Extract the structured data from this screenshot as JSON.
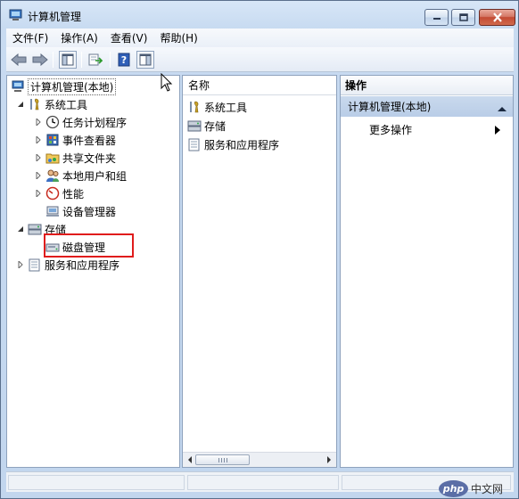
{
  "window": {
    "title": "计算机管理"
  },
  "menubar": {
    "items": [
      "文件(F)",
      "操作(A)",
      "查看(V)",
      "帮助(H)"
    ]
  },
  "tree": {
    "root": "计算机管理(本地)",
    "system_tools": "系统工具",
    "task_scheduler": "任务计划程序",
    "event_viewer": "事件查看器",
    "shared_folders": "共享文件夹",
    "local_users": "本地用户和组",
    "performance": "性能",
    "device_manager": "设备管理器",
    "storage": "存储",
    "disk_management": "磁盘管理",
    "services_apps": "服务和应用程序"
  },
  "list": {
    "header": "名称",
    "items": [
      "系统工具",
      "存储",
      "服务和应用程序"
    ]
  },
  "actions": {
    "header": "操作",
    "section": "计算机管理(本地)",
    "more": "更多操作"
  },
  "watermark": {
    "badge": "php",
    "text": "中文网"
  },
  "colors": {
    "highlight": "#e01c1c",
    "action_section_bg": "#c9d9ed",
    "close_button": "#c34a33"
  }
}
